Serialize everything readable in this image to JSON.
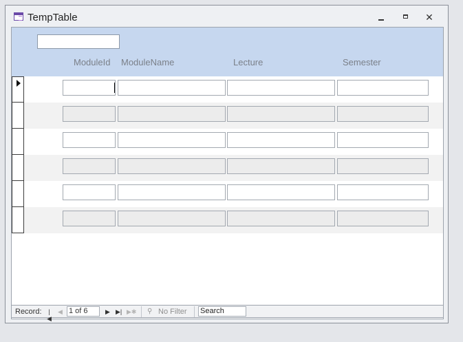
{
  "window": {
    "title": "TempTable"
  },
  "header": {
    "columns": [
      {
        "label": "ModuleId"
      },
      {
        "label": "ModuleName"
      },
      {
        "label": "Lecture"
      },
      {
        "label": "Semester"
      }
    ]
  },
  "records": [
    {
      "module_id": "",
      "module_name": "",
      "lecture": "",
      "semester": "",
      "current": true
    },
    {
      "module_id": "",
      "module_name": "",
      "lecture": "",
      "semester": ""
    },
    {
      "module_id": "",
      "module_name": "",
      "lecture": "",
      "semester": ""
    },
    {
      "module_id": "",
      "module_name": "",
      "lecture": "",
      "semester": ""
    },
    {
      "module_id": "",
      "module_name": "",
      "lecture": "",
      "semester": ""
    },
    {
      "module_id": "",
      "module_name": "",
      "lecture": "",
      "semester": ""
    }
  ],
  "navigation": {
    "record_label": "Record:",
    "position": "1 of 6",
    "filter_label": "No Filter",
    "search_label": "Search"
  },
  "colors": {
    "header_bg": "#c6d7ef",
    "alt_row_bg": "#f2f2f2"
  }
}
